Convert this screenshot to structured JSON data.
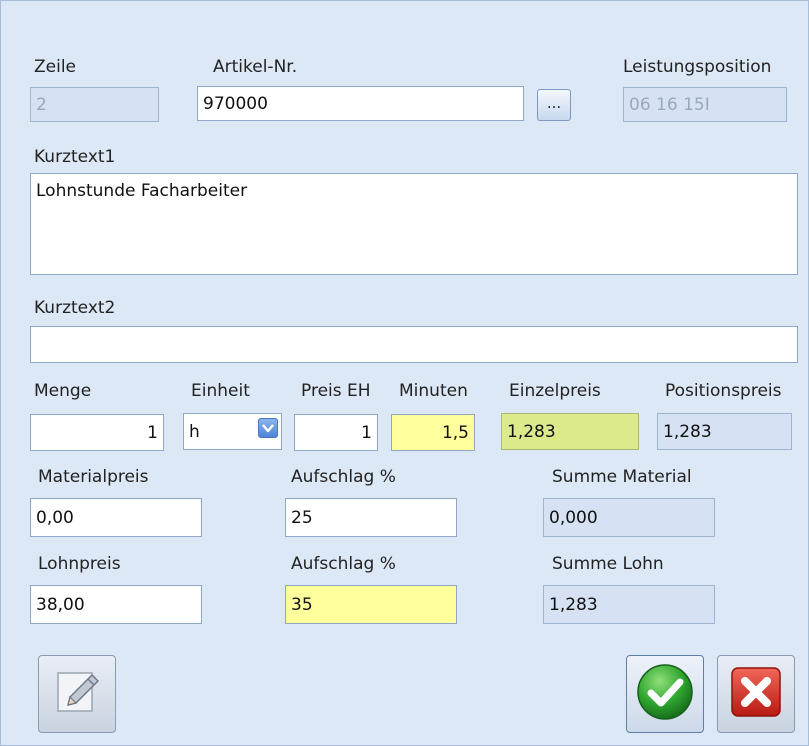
{
  "form": {
    "zeile": {
      "label": "Zeile",
      "value": "2"
    },
    "artikel": {
      "label": "Artikel-Nr.",
      "value": "970000",
      "browse_label": "..."
    },
    "leistung": {
      "label": "Leistungsposition",
      "value": "06 16 15I"
    },
    "kurztext1": {
      "label": "Kurztext1",
      "value": "Lohnstunde Facharbeiter"
    },
    "kurztext2": {
      "label": "Kurztext2",
      "value": ""
    },
    "menge": {
      "label": "Menge",
      "value": "1"
    },
    "einheit": {
      "label": "Einheit",
      "value": "h"
    },
    "preis_eh": {
      "label": "Preis EH",
      "value": "1"
    },
    "minuten": {
      "label": "Minuten",
      "value": "1,5"
    },
    "einzelpreis": {
      "label": "Einzelpreis",
      "value": "1,283"
    },
    "positionspreis": {
      "label": "Positionspreis",
      "value": "1,283"
    },
    "materialpreis": {
      "label": "Materialpreis",
      "value": "0,00"
    },
    "aufschlag_material": {
      "label": "Aufschlag %",
      "value": "25"
    },
    "summe_material": {
      "label": "Summe Material",
      "value": "0,000"
    },
    "lohnpreis": {
      "label": "Lohnpreis",
      "value": "38,00"
    },
    "aufschlag_lohn": {
      "label": "Aufschlag %",
      "value": "35"
    },
    "summe_lohn": {
      "label": "Summe Lohn",
      "value": "1,283"
    }
  },
  "buttons": {
    "edit_icon": "pencil-icon",
    "ok_icon": "checkmark-icon",
    "cancel_icon": "close-icon"
  },
  "colors": {
    "background": "#dde8f6",
    "highlight_yellow": "#ffff9b",
    "highlight_lime": "#dcea8c",
    "readonly": "#d6e2f3",
    "ok_green": "#2fa52f",
    "cancel_red": "#d42a1e"
  }
}
